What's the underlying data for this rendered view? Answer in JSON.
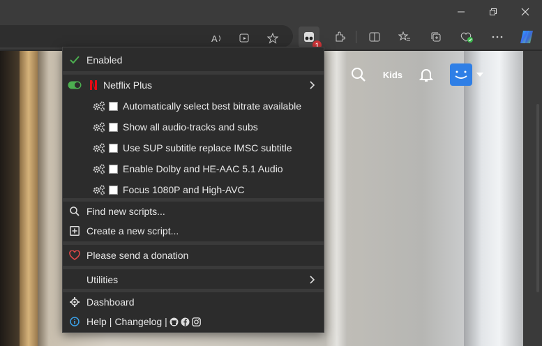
{
  "window": {
    "controls": [
      "minimize-icon",
      "restore-icon",
      "close-icon"
    ]
  },
  "toolbar": {
    "icons": [
      "read-aloud-icon",
      "immersive-reader-icon",
      "favorite-star-icon",
      "tampermonkey-icon",
      "extensions-icon",
      "split-screen-icon",
      "favorites-icon",
      "collections-icon",
      "browser-essentials-icon",
      "more-icon",
      "copilot-icon"
    ],
    "extension_badge": "1"
  },
  "netflix": {
    "kids_label": "Kids"
  },
  "menu": {
    "enabled_label": "Enabled",
    "script_name": "Netflix Plus",
    "options": [
      "Automatically select best bitrate available",
      "Show all audio-tracks and subs",
      "Use SUP subtitle replace IMSC subtitle",
      "Enable Dolby and HE-AAC 5.1 Audio",
      "Focus 1080P and High-AVC"
    ],
    "find_scripts": "Find new scripts...",
    "create_script": "Create a new script...",
    "donation": "Please send a donation",
    "utilities": "Utilities",
    "dashboard": "Dashboard",
    "help": "Help",
    "changelog": "Changelog",
    "link_separator": "|"
  },
  "colors": {
    "menu_bg": "#2c2c2c",
    "accent_green": "#4caf50",
    "heart_red": "#e04848",
    "netflix_red": "#e50914",
    "info_blue": "#3ba1e8"
  }
}
